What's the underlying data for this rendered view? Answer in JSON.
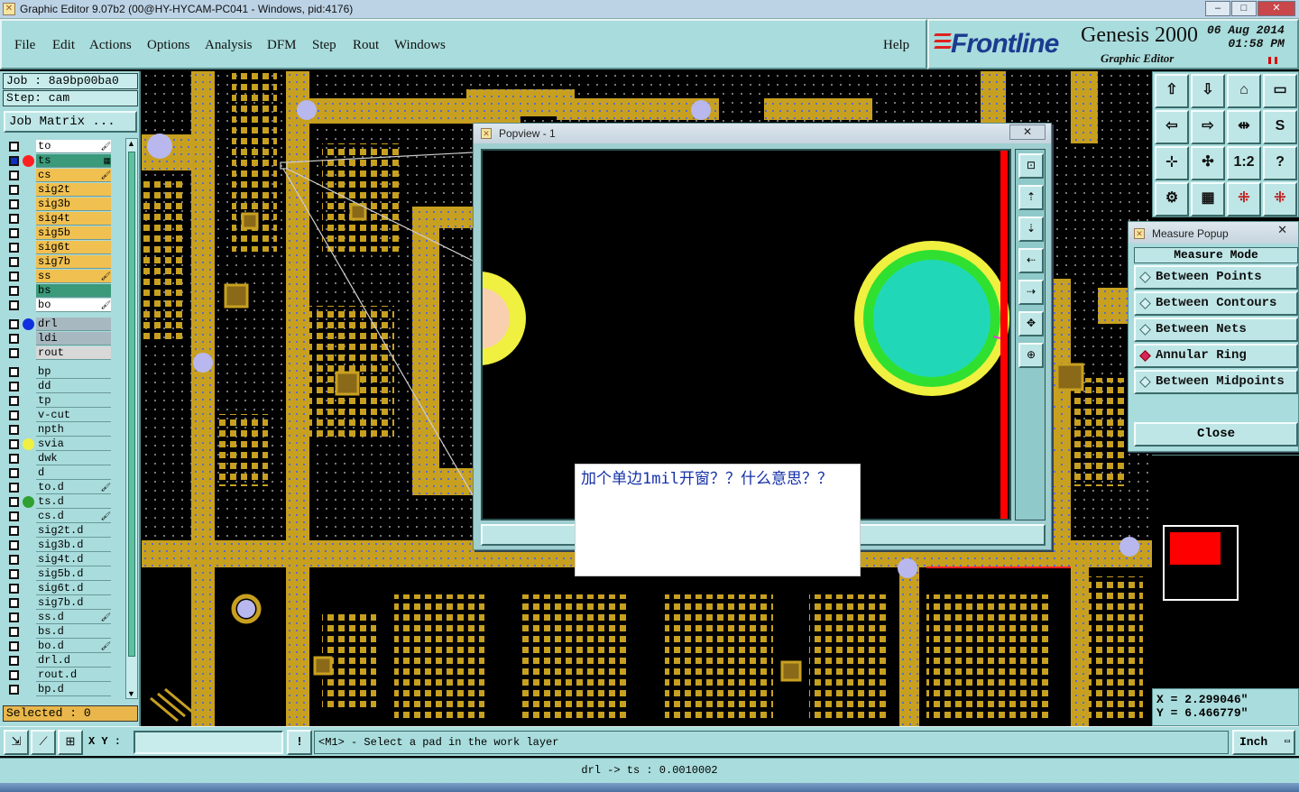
{
  "window": {
    "title": "Graphic Editor 9.07b2 (00@HY-HYCAM-PC041 - Windows, pid:4176)",
    "minimize": "‒",
    "maximize": "□",
    "close": "✕"
  },
  "menu": {
    "items": [
      "File",
      "Edit",
      "Actions",
      "Options",
      "Analysis",
      "DFM",
      "Step",
      "Rout",
      "Windows"
    ],
    "help": "Help"
  },
  "brand": {
    "logo": "Frontline",
    "product": "Genesis 2000",
    "subtitle": "Graphic Editor",
    "date": "06 Aug 2014",
    "time": "01:58 PM"
  },
  "job": {
    "job_line": "Job : 8a9bp00ba0",
    "step_line": "Step: cam",
    "matrix_button": "Job Matrix ..."
  },
  "layers": [
    {
      "name": "to",
      "color": "#ffffff",
      "mark": "🖌",
      "dot": ""
    },
    {
      "name": "ts",
      "color": "#3a9a7a",
      "mark": "▦",
      "dot": "#ff2020",
      "work": true
    },
    {
      "name": "cs",
      "color": "#f0c050",
      "mark": "🖌",
      "dot": ""
    },
    {
      "name": "sig2t",
      "color": "#f0c050",
      "mark": "",
      "dot": ""
    },
    {
      "name": "sig3b",
      "color": "#f0c050",
      "mark": "",
      "dot": ""
    },
    {
      "name": "sig4t",
      "color": "#f0c050",
      "mark": "",
      "dot": ""
    },
    {
      "name": "sig5b",
      "color": "#f0c050",
      "mark": "",
      "dot": ""
    },
    {
      "name": "sig6t",
      "color": "#f0c050",
      "mark": "",
      "dot": ""
    },
    {
      "name": "sig7b",
      "color": "#f0c050",
      "mark": "",
      "dot": ""
    },
    {
      "name": "ss",
      "color": "#f0c050",
      "mark": "🖌",
      "dot": ""
    },
    {
      "name": "bs",
      "color": "#3a9a7a",
      "mark": "",
      "dot": ""
    },
    {
      "name": "bo",
      "color": "#ffffff",
      "mark": "🖌",
      "dot": ""
    },
    {
      "name": "drl",
      "color": "#a8b8c0",
      "mark": "",
      "dot": "#1030e0",
      "gap": true
    },
    {
      "name": "ldi",
      "color": "#a8b8c0",
      "mark": "",
      "dot": ""
    },
    {
      "name": "rout",
      "color": "#d8d8d8",
      "mark": "",
      "dot": ""
    },
    {
      "name": "bp",
      "color": "#a9dcdc",
      "mark": "",
      "dot": "",
      "gap": true
    },
    {
      "name": "dd",
      "color": "#a9dcdc",
      "mark": "",
      "dot": ""
    },
    {
      "name": "tp",
      "color": "#a9dcdc",
      "mark": "",
      "dot": ""
    },
    {
      "name": "v-cut",
      "color": "#a9dcdc",
      "mark": "",
      "dot": ""
    },
    {
      "name": "npth",
      "color": "#a9dcdc",
      "mark": "",
      "dot": ""
    },
    {
      "name": "svia",
      "color": "#a9dcdc",
      "mark": "",
      "dot": "#f0f040"
    },
    {
      "name": "dwk",
      "color": "#a9dcdc",
      "mark": "",
      "dot": ""
    },
    {
      "name": "d",
      "color": "#a9dcdc",
      "mark": "",
      "dot": ""
    },
    {
      "name": "to.d",
      "color": "#a9dcdc",
      "mark": "🖌",
      "dot": ""
    },
    {
      "name": "ts.d",
      "color": "#a9dcdc",
      "mark": "",
      "dot": "#30a030"
    },
    {
      "name": "cs.d",
      "color": "#a9dcdc",
      "mark": "🖌",
      "dot": ""
    },
    {
      "name": "sig2t.d",
      "color": "#a9dcdc",
      "mark": "",
      "dot": ""
    },
    {
      "name": "sig3b.d",
      "color": "#a9dcdc",
      "mark": "",
      "dot": ""
    },
    {
      "name": "sig4t.d",
      "color": "#a9dcdc",
      "mark": "",
      "dot": ""
    },
    {
      "name": "sig5b.d",
      "color": "#a9dcdc",
      "mark": "",
      "dot": ""
    },
    {
      "name": "sig6t.d",
      "color": "#a9dcdc",
      "mark": "",
      "dot": ""
    },
    {
      "name": "sig7b.d",
      "color": "#a9dcdc",
      "mark": "",
      "dot": ""
    },
    {
      "name": "ss.d",
      "color": "#a9dcdc",
      "mark": "🖌",
      "dot": ""
    },
    {
      "name": "bs.d",
      "color": "#a9dcdc",
      "mark": "",
      "dot": ""
    },
    {
      "name": "bo.d",
      "color": "#a9dcdc",
      "mark": "🖌",
      "dot": ""
    },
    {
      "name": "drl.d",
      "color": "#a9dcdc",
      "mark": "",
      "dot": ""
    },
    {
      "name": "rout.d",
      "color": "#a9dcdc",
      "mark": "",
      "dot": ""
    },
    {
      "name": "bp.d",
      "color": "#a9dcdc",
      "mark": "",
      "dot": ""
    }
  ],
  "selected_label": "Selected : 0",
  "popview": {
    "title": "Popview - 1",
    "close": "✕"
  },
  "note": {
    "text": "加个单边1mil开窗？？什么意思？？"
  },
  "measure": {
    "title": "Measure Popup",
    "close_x": "✕",
    "mode_label": "Measure Mode",
    "options": [
      {
        "label": "Between Points",
        "selected": false
      },
      {
        "label": "Between Contours",
        "selected": false
      },
      {
        "label": "Between Nets",
        "selected": false
      },
      {
        "label": "Annular Ring",
        "selected": true
      },
      {
        "label": "Between Midpoints",
        "selected": false
      }
    ],
    "close_button": "Close"
  },
  "coords": {
    "x": "X = 2.299046\"",
    "y": "Y = 6.466779\""
  },
  "bottom": {
    "xy_label": "X Y :",
    "xy_value": "",
    "prompt": "<M1> - Select a pad in the work layer",
    "units": "Inch",
    "warn": "!"
  },
  "status": {
    "text": "drl -> ts : 0.0010002"
  },
  "colors": {
    "copper": "#c8a020",
    "panel": "#a9dcdc",
    "board": "#000000",
    "mask_ring": "#f0f040",
    "pad_fill": "#20d8b8",
    "ring_green": "#30e030",
    "accent_red": "#ff0000"
  }
}
